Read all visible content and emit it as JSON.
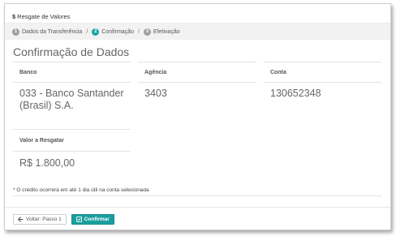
{
  "header": {
    "icon": "dollar-icon",
    "title": "Resgate de Valores",
    "symbol": "$"
  },
  "steps": [
    {
      "number": "1",
      "label": "Dados da Transferência",
      "state": "done"
    },
    {
      "number": "2",
      "label": "Confirmação",
      "state": "active"
    },
    {
      "number": "3",
      "label": "Efetivação",
      "state": "pending"
    }
  ],
  "separator": "/",
  "section_title": "Confirmação de Dados",
  "fields": {
    "banco": {
      "label": "Banco",
      "value": "033 - Banco Santander (Brasil) S.A."
    },
    "agencia": {
      "label": "Agência",
      "value": "3403"
    },
    "conta": {
      "label": "Conta",
      "value": "130652348"
    },
    "valor": {
      "label": "Valor a Resgatar",
      "value": "R$ 1.800,00"
    }
  },
  "note": "* O crédito ocorrerá em até 1 dia útil na conta selecionada",
  "buttons": {
    "back": {
      "label": "Voltar: Passo 1",
      "icon": "arrow-left-icon"
    },
    "confirm": {
      "label": "Confirmar",
      "icon": "check-square-icon"
    }
  },
  "colors": {
    "accent": "#1a9e9e",
    "step_active": "#1aa5a5",
    "step_inactive": "#9e9e9e"
  }
}
